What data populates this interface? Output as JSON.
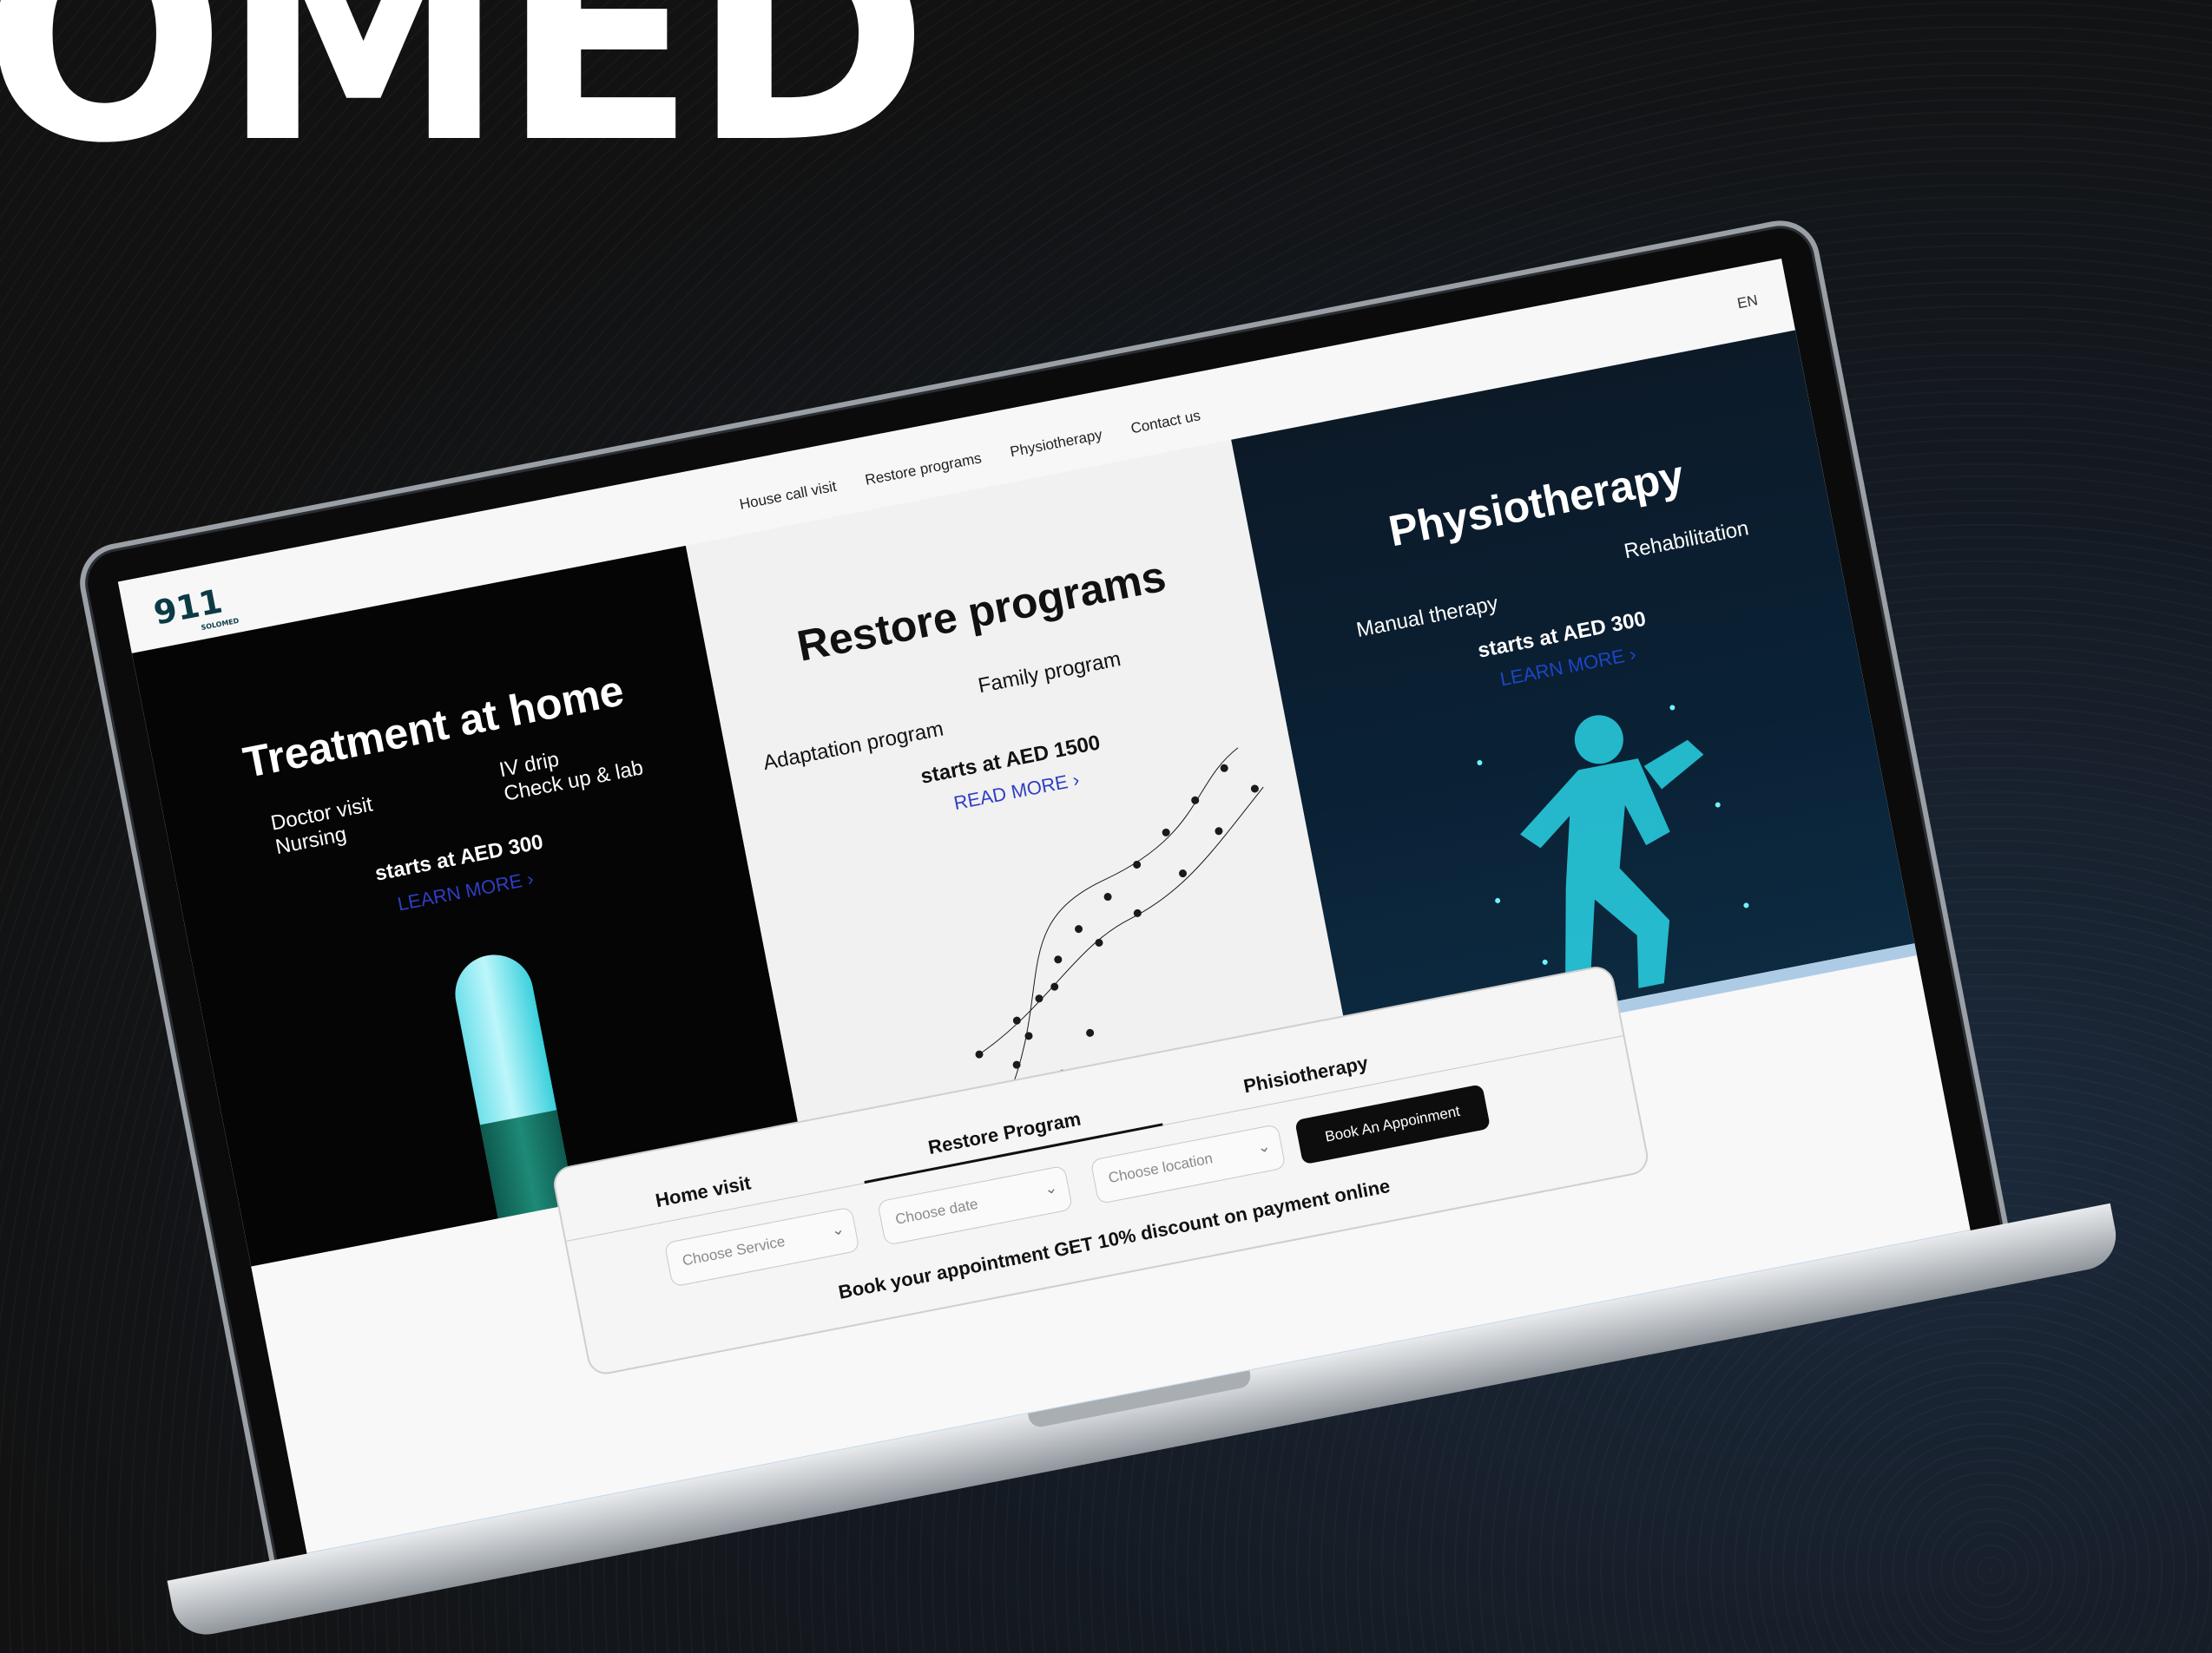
{
  "background": {
    "brand_text": "OMED",
    "colors": {
      "bg": "#121212",
      "accent_blue": "#2f3ec4"
    }
  },
  "site": {
    "logo": {
      "number": "911",
      "sub": "SOLOMED"
    },
    "nav": [
      "House call visit",
      "Restore programs",
      "Physiotherapy",
      "Contact us"
    ],
    "lang": "EN"
  },
  "panels": {
    "treatment": {
      "title": "Treatment at home",
      "features_left": [
        "Doctor visit",
        "Nursing"
      ],
      "features_right": [
        "IV drip",
        "Check up & lab"
      ],
      "price": "starts at AED 300",
      "cta": "LEARN MORE ›"
    },
    "restore": {
      "title": "Restore programs",
      "feature_left": "Adaptation program",
      "feature_right": "Family program",
      "price": "starts at AED 1500",
      "cta": "READ MORE ›"
    },
    "physio": {
      "title": "Physiotherapy",
      "feature_left": "Manual therapy",
      "feature_right": "Rehabilitation",
      "price": "starts at AED 300",
      "cta": "LEARN MORE ›"
    }
  },
  "booking": {
    "tabs": [
      "Home visit",
      "Restore Program",
      "Phisiotherapy"
    ],
    "active_tab": "Restore Program",
    "service_placeholder": "Choose Service",
    "date_placeholder": "Choose date",
    "location_placeholder": "Choose location",
    "button": "Book An Appoinment",
    "promo": "Book your appointment GET 10% discount on payment online"
  }
}
